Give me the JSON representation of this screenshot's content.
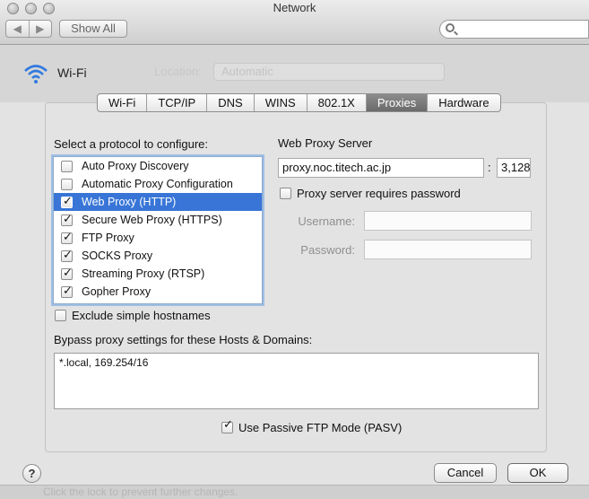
{
  "window": {
    "title": "Network",
    "nav_back": "◀",
    "nav_forward": "▶",
    "show_all_label": "Show All"
  },
  "background": {
    "network_name": "Wi-Fi",
    "location_label": "Location:",
    "location_value": "Automatic",
    "footer_text": "Click the lock to prevent further changes."
  },
  "tabs": [
    {
      "label": "Wi-Fi"
    },
    {
      "label": "TCP/IP"
    },
    {
      "label": "DNS"
    },
    {
      "label": "WINS"
    },
    {
      "label": "802.1X"
    },
    {
      "label": "Proxies",
      "active": true
    },
    {
      "label": "Hardware"
    }
  ],
  "protocols": {
    "heading": "Select a protocol to configure:",
    "items": [
      {
        "label": "Auto Proxy Discovery",
        "checked": false
      },
      {
        "label": "Automatic Proxy Configuration",
        "checked": false
      },
      {
        "label": "Web Proxy (HTTP)",
        "checked": true,
        "selected": true
      },
      {
        "label": "Secure Web Proxy (HTTPS)",
        "checked": true
      },
      {
        "label": "FTP Proxy",
        "checked": true
      },
      {
        "label": "SOCKS Proxy",
        "checked": true
      },
      {
        "label": "Streaming Proxy (RTSP)",
        "checked": true
      },
      {
        "label": "Gopher Proxy",
        "checked": true
      }
    ]
  },
  "proxy_server": {
    "heading": "Web Proxy Server",
    "host": "proxy.noc.titech.ac.jp",
    "colon": ":",
    "port": "3,128",
    "requires_password_label": "Proxy server requires password",
    "requires_password": false,
    "username_label": "Username:",
    "password_label": "Password:"
  },
  "exclude_simple_hostnames": {
    "label": "Exclude simple hostnames",
    "checked": false
  },
  "bypass": {
    "heading": "Bypass proxy settings for these Hosts & Domains:",
    "value": "*.local, 169.254/16"
  },
  "passive_ftp": {
    "label": "Use Passive FTP Mode (PASV)",
    "checked": true
  },
  "buttons": {
    "help": "?",
    "cancel": "Cancel",
    "ok": "OK"
  }
}
